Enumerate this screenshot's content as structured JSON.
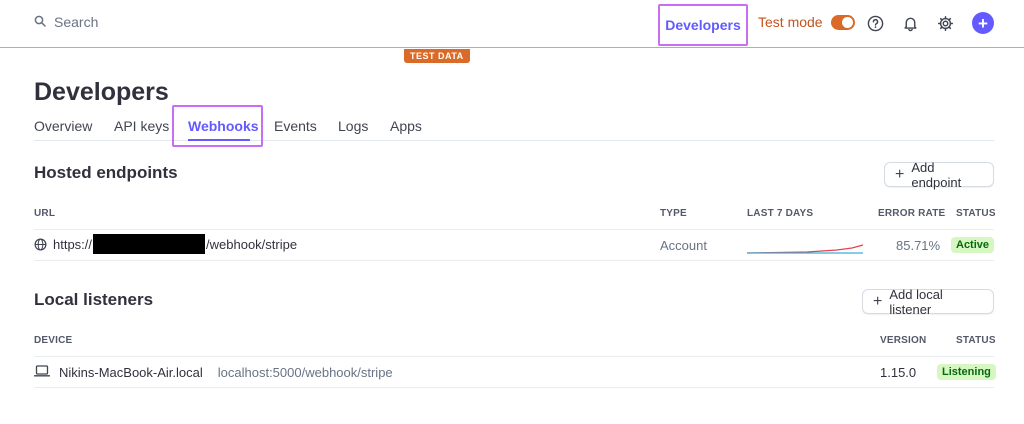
{
  "topbar": {
    "search_placeholder": "Search",
    "developers_label": "Developers",
    "test_mode_label": "Test mode",
    "test_mode_on": true,
    "test_data_badge": "TEST DATA",
    "plus_label": "+"
  },
  "page": {
    "title": "Developers",
    "tabs": [
      {
        "label": "Overview"
      },
      {
        "label": "API keys"
      },
      {
        "label": "Webhooks",
        "active": true
      },
      {
        "label": "Events"
      },
      {
        "label": "Logs"
      },
      {
        "label": "Apps"
      }
    ]
  },
  "hosted": {
    "title": "Hosted endpoints",
    "add_button": "Add endpoint",
    "columns": {
      "url": "URL",
      "type": "TYPE",
      "last7": "LAST 7 DAYS",
      "error_rate": "ERROR RATE",
      "status": "STATUS"
    },
    "rows": [
      {
        "url_prefix": "https://",
        "url_suffix": "/webhook/stripe",
        "type": "Account",
        "error_rate": "85.71%",
        "status": "Active"
      }
    ]
  },
  "local": {
    "title": "Local listeners",
    "add_button": "Add local listener",
    "columns": {
      "device": "DEVICE",
      "version": "VERSION",
      "status": "STATUS"
    },
    "rows": [
      {
        "device": "Nikins-MacBook-Air.local",
        "endpoint": "localhost:5000/webhook/stripe",
        "version": "1.15.0",
        "status": "Listening"
      }
    ]
  },
  "colors": {
    "accent": "#635bff",
    "test_mode": "#d96a27",
    "highlight": "#c86ef2",
    "status_bg": "#d7f7c2",
    "status_text": "#05690d"
  }
}
